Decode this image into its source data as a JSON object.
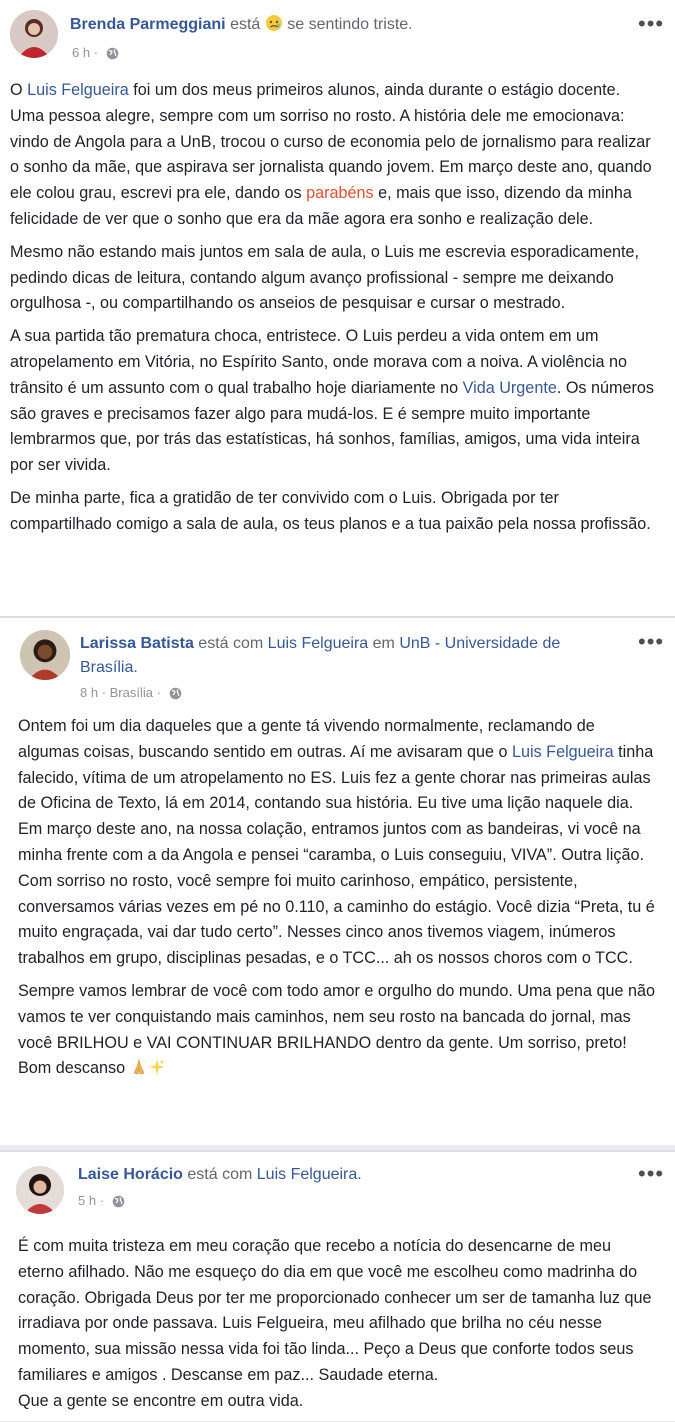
{
  "post1": {
    "author": "Brenda Parmeggiani",
    "esta": "está",
    "feeling": "se sentindo triste.",
    "time": "6 h",
    "more": "•••",
    "paragraphs": {
      "p1": {
        "t1": "O ",
        "link1": "Luis Felgueira",
        "t2": " foi um dos meus primeiros alunos, ainda durante o estágio docente. Uma pessoa alegre, sempre com um sorriso no rosto. A história dele me emocionava: vindo de Angola para a UnB, trocou o curso de economia pelo de jornalismo para realizar o sonho da mãe, que aspirava ser jornalista quando jovem. Em março deste ano, quando ele colou grau, escrevi pra ele, dando os ",
        "highlight": "parabéns",
        "t3": " e, mais que isso, dizendo da minha felicidade de ver que o sonho que era da mãe agora era sonho e realização dele."
      },
      "p2": "Mesmo não estando mais juntos em sala de aula, o Luis me escrevia esporadicamente, pedindo dicas de leitura, contando algum avanço profissional - sempre me deixando orgulhosa -, ou compartilhando os anseios de pesquisar e cursar o mestrado.",
      "p3": {
        "t1": "A sua partida tão prematura choca, entristece. O Luis perdeu a vida ontem em um atropelamento em Vitória, no Espírito Santo, onde morava com a noiva. A violência no trânsito é um assunto com o qual trabalho hoje diariamente no ",
        "link": "Vida Urgente",
        "t2": ". Os números são graves e precisamos fazer algo para mudá-los. E é sempre muito importante lembrarmos que, por trás das estatísticas, há sonhos, famílias, amigos, uma vida inteira por ser vivida."
      },
      "p4": "De minha parte, fica a gratidão de ter convivido com o Luis. Obrigada por ter compartilhado comigo a sala de aula, os teus planos e a tua paixão pela nossa profissão."
    }
  },
  "post2": {
    "author": "Larissa Batista",
    "esta_com": "está com",
    "tagged": "Luis Felgueira",
    "em": "em",
    "place": "UnB - Universidade de Brasília.",
    "time": "8 h",
    "location": "Brasília",
    "more": "•••",
    "paragraphs": {
      "p1": {
        "t1": "Ontem foi um dia daqueles que a gente tá vivendo normalmente, reclamando de algumas coisas, buscando sentido em outras. Aí me avisaram que o ",
        "link": "Luis Felgueira",
        "t2": " tinha falecido, vítima de um atropelamento no ES. Luis fez a gente chorar nas primeiras aulas de Oficina de Texto, lá em 2014, contando sua história. Eu tive uma lição naquele dia. Em março deste ano, na nossa colação, entramos juntos com as bandeiras, vi você na minha frente com a da Angola e pensei “caramba, o Luis conseguiu, VIVA”. Outra lição. Com sorriso no rosto, você sempre foi muito carinhoso, empático, persistente, conversamos várias vezes em pé no 0.110, a caminho do estágio. Você dizia “Preta, tu é muito engraçada, vai dar tudo certo”. Nesses cinco anos tivemos viagem, inúmeros trabalhos em grupo, disciplinas pesadas, e o TCC... ah os nossos choros com o TCC."
      },
      "p2": "Sempre vamos lembrar de você com todo amor e orgulho do mundo. Uma pena que não vamos te ver conquistando mais caminhos, nem seu rosto na bancada do jornal, mas você BRILHOU e VAI CONTINUAR BRILHANDO dentro da gente. Um sorriso, preto! Bom descanso"
    }
  },
  "post3": {
    "author": "Laise Horácio",
    "esta_com": "está com",
    "tagged": "Luis Felgueira.",
    "time": "5 h",
    "more": "•••",
    "paragraphs": {
      "p1": "É com muita tristeza em meu coração que recebo a notícia do desencarne de meu eterno afilhado. Não me esqueço do dia em que você me escolheu como madrinha do coração. Obrigada Deus por ter me proporcionado conhecer um ser de tamanha luz que irradiava por onde passava. Luis Felgueira, meu afilhado que brilha no céu nesse momento, sua missão nessa vida foi tão linda... Peço a Deus que conforte todos seus familiares e amigos . Descanse em paz... Saudade eterna.",
      "p2": "Que a gente se encontre em outra vida."
    }
  }
}
